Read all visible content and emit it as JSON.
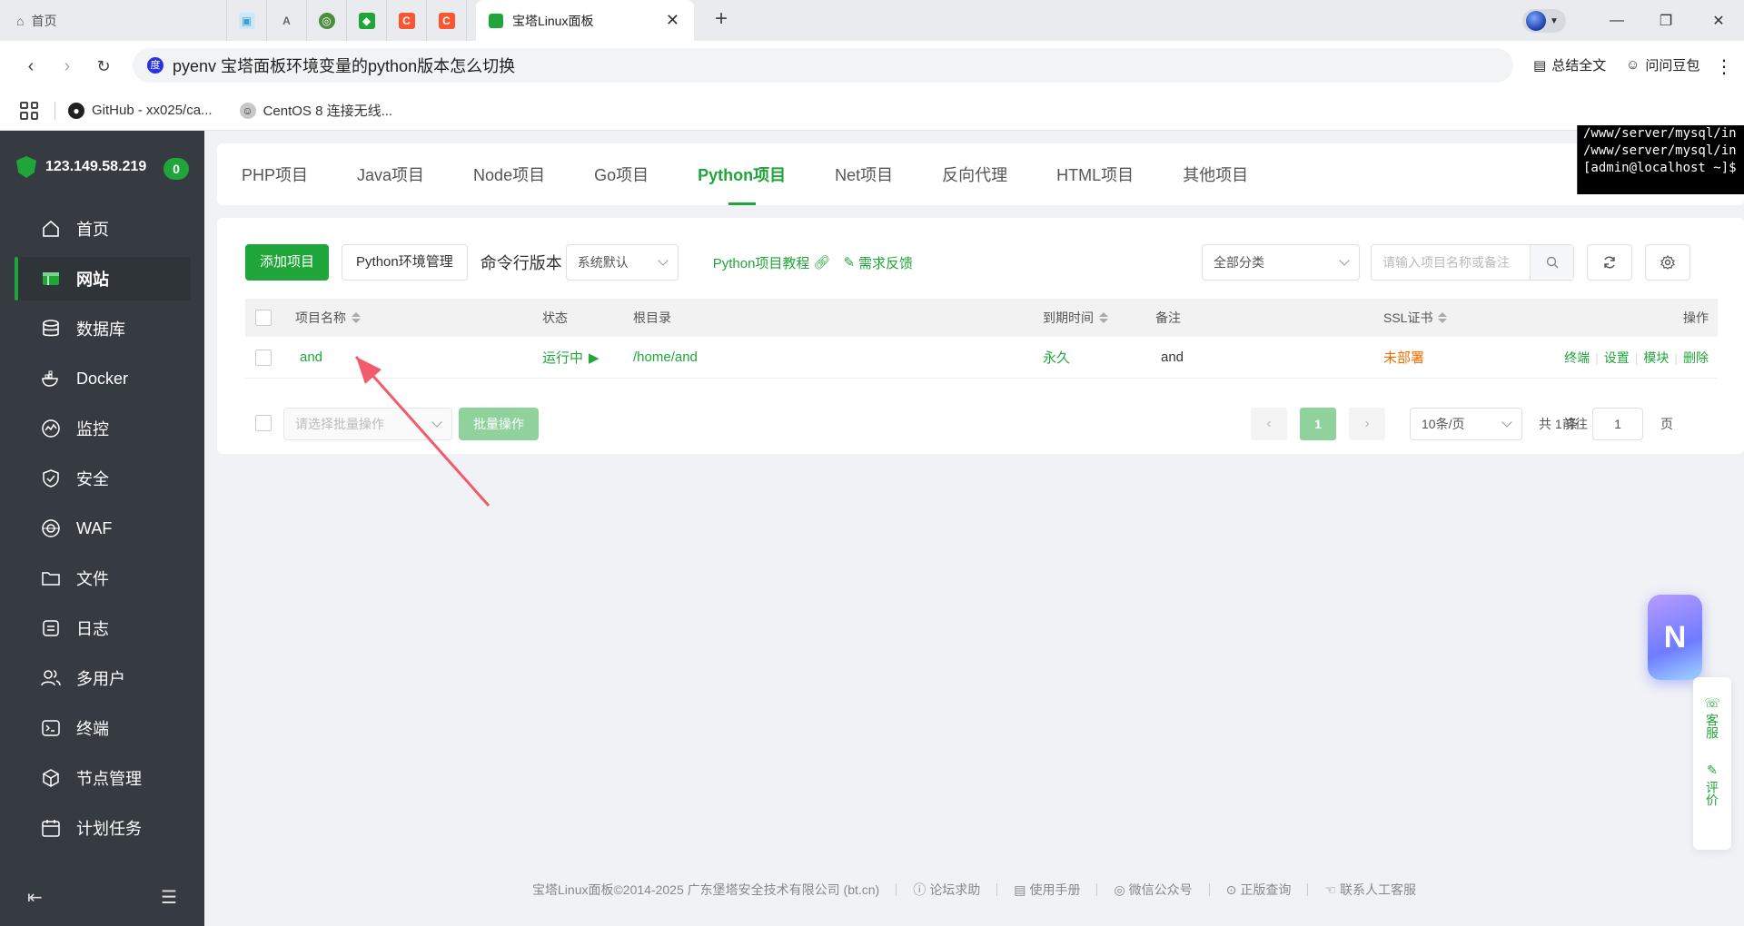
{
  "browser": {
    "home_tab": "首页",
    "active_tab": "宝塔Linux面板",
    "omnibox_text": "pyenv 宝塔面板环境变量的python版本怎么切换",
    "summary_label": "总结全文",
    "ask_label": "问问豆包",
    "bookmarks": [
      {
        "label": "GitHub - xx025/ca..."
      },
      {
        "label": "CentOS 8 连接无线..."
      }
    ]
  },
  "sidebar": {
    "server_ip": "123.149.58.219",
    "badge": "0",
    "items": [
      {
        "label": "首页",
        "icon": "home-icon"
      },
      {
        "label": "网站",
        "icon": "website-icon"
      },
      {
        "label": "数据库",
        "icon": "database-icon"
      },
      {
        "label": "Docker",
        "icon": "docker-icon"
      },
      {
        "label": "监控",
        "icon": "monitor-icon"
      },
      {
        "label": "安全",
        "icon": "security-icon"
      },
      {
        "label": "WAF",
        "icon": "waf-icon"
      },
      {
        "label": "文件",
        "icon": "folder-icon"
      },
      {
        "label": "日志",
        "icon": "log-icon"
      },
      {
        "label": "多用户",
        "icon": "users-icon"
      },
      {
        "label": "终端",
        "icon": "terminal-icon"
      },
      {
        "label": "节点管理",
        "icon": "node-icon"
      },
      {
        "label": "计划任务",
        "icon": "calendar-icon"
      }
    ]
  },
  "project_tabs": [
    "PHP项目",
    "Java项目",
    "Node项目",
    "Go项目",
    "Python项目",
    "Net项目",
    "反向代理",
    "HTML项目",
    "其他项目"
  ],
  "toolbar": {
    "add_project": "添加项目",
    "env_manage": "Python环境管理",
    "cmd_version_label": "命令行版本",
    "cmd_version_value": "系统默认",
    "tutorial_link": "Python项目教程",
    "feedback_link": "需求反馈",
    "category_value": "全部分类",
    "search_placeholder": "请输入项目名称或备注"
  },
  "table": {
    "headers": {
      "name": "项目名称",
      "status": "状态",
      "root": "根目录",
      "expire": "到期时间",
      "remark": "备注",
      "ssl": "SSL证书",
      "ops": "操作"
    },
    "rows": [
      {
        "name": "and",
        "status": "运行中",
        "root": "/home/and",
        "expire": "永久",
        "remark": "and",
        "ssl": "未部署",
        "ops": [
          "终端",
          "设置",
          "模块",
          "删除"
        ]
      }
    ]
  },
  "batch": {
    "select_placeholder": "请选择批量操作",
    "button": "批量操作"
  },
  "pagination": {
    "current_page": "1",
    "page_size": "10条/页",
    "total": "共 1 条",
    "goto_label": "前往",
    "goto_value": "1",
    "page_suffix": "页"
  },
  "footer": {
    "copyright": "宝塔Linux面板©2014-2025 广东堡塔安全技术有限公司 (bt.cn)",
    "links": [
      "论坛求助",
      "使用手册",
      "微信公众号",
      "正版查询",
      "联系人工客服"
    ]
  },
  "terminal_lines": [
    "/www/server/mysql/in",
    "/www/server/mysql/in",
    "[admin@localhost ~]$"
  ],
  "float_side": {
    "service": "客服",
    "review": "评价"
  },
  "colors": {
    "accent": "#20a53a",
    "sidebar_bg": "#363b41",
    "warning": "#f56c00"
  }
}
